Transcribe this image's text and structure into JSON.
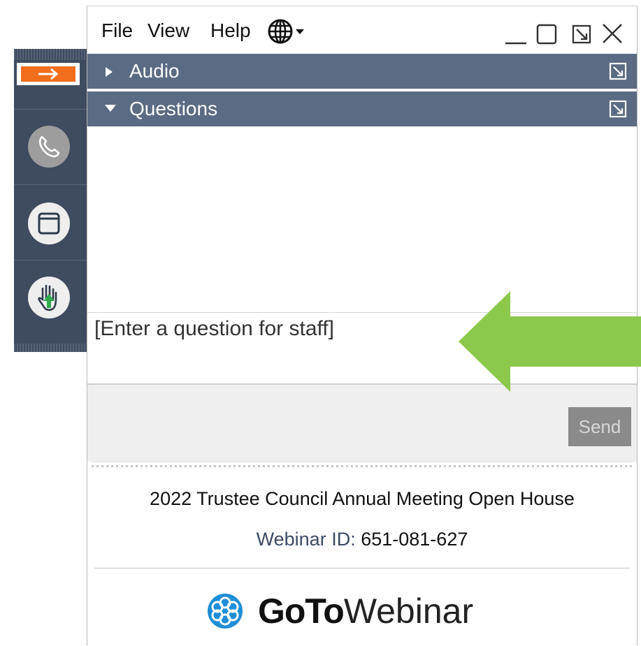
{
  "menu": {
    "file": "File",
    "view": "View",
    "help": "Help",
    "language_icon": "globe-icon"
  },
  "window_controls": [
    "minimize-icon",
    "maximize-icon",
    "popout-icon",
    "close-icon"
  ],
  "sections": {
    "audio": {
      "label": "Audio",
      "expanded": false
    },
    "questions": {
      "label": "Questions",
      "expanded": true
    }
  },
  "question_input": {
    "placeholder": "[Enter a question for staff]",
    "value": ""
  },
  "send_button": {
    "label": "Send",
    "enabled": false
  },
  "webinar": {
    "title": "2022 Trustee Council Annual Meeting Open House",
    "id_label": "Webinar ID:",
    "id_value": "651-081-627"
  },
  "logo": {
    "part1": "GoTo",
    "part2": "Webinar"
  },
  "sidebar_icons": [
    "arrow-right-icon",
    "phone-icon",
    "window-icon",
    "raise-hand-icon"
  ],
  "colors": {
    "header": "#5b6b83",
    "sidebar": "#3f4b5f",
    "accent_orange": "#f06e1c",
    "highlight_arrow": "#8cc84b",
    "logo_blue": "#1f8ed6"
  }
}
